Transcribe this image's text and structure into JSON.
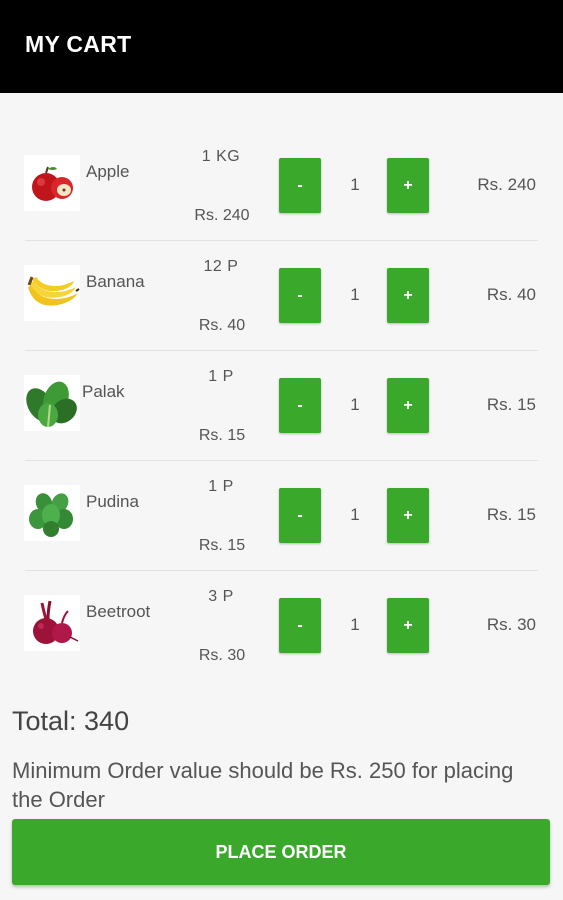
{
  "appbar": {
    "title": "MY CART"
  },
  "items": [
    {
      "name": "Apple",
      "qty": "1 KG",
      "price": "Rs. 240",
      "count": "1",
      "total": "Rs. 240",
      "icon": "apple-icon"
    },
    {
      "name": "Banana",
      "qty": "12 P",
      "price": "Rs. 40",
      "count": "1",
      "total": "Rs. 40",
      "icon": "banana-icon"
    },
    {
      "name": "Palak",
      "qty": "1 P",
      "price": "Rs. 15",
      "count": "1",
      "total": "Rs. 15",
      "icon": "palak-icon"
    },
    {
      "name": "Pudina",
      "qty": "1 P",
      "price": "Rs. 15",
      "count": "1",
      "total": "Rs. 15",
      "icon": "pudina-icon"
    },
    {
      "name": "Beetroot",
      "qty": "3 P",
      "price": "Rs. 30",
      "count": "1",
      "total": "Rs. 30",
      "icon": "beetroot-icon"
    }
  ],
  "buttons": {
    "minus": "-",
    "plus": "+"
  },
  "summary": {
    "total": "Total: 340",
    "note": "Minimum Order value should be Rs. 250 for placing the Order",
    "place_order": "PLACE ORDER"
  },
  "colors": {
    "appbar": "#000000",
    "accent": "#3aa82a",
    "background": "#f6f6f6"
  }
}
